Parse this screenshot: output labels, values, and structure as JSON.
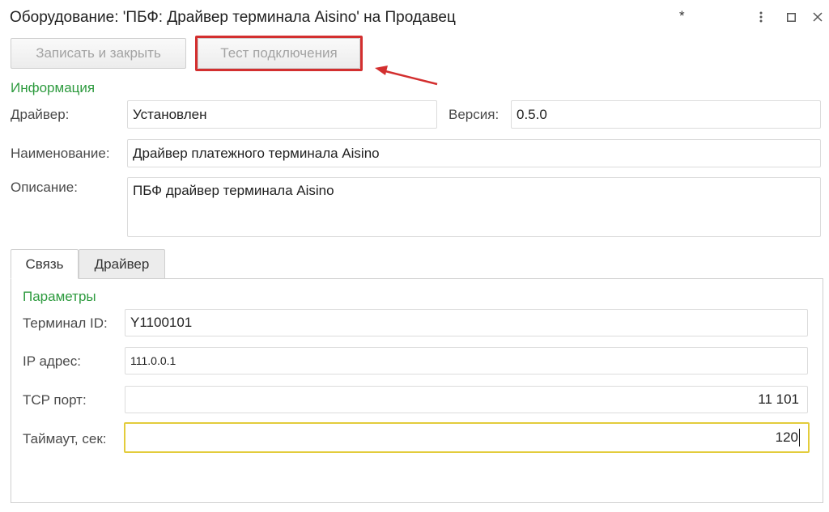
{
  "window": {
    "title": "Оборудование: 'ПБФ: Драйвер терминала Aisino' на Продавец",
    "modified_mark": "*",
    "more_icon": "more-vertical-icon",
    "maximize_icon": "maximize-icon",
    "close_icon": "close-icon"
  },
  "toolbar": {
    "save_close_label": "Записать и закрыть",
    "test_connection_label": "Тест подключения",
    "highlight_color": "#d32f2f"
  },
  "info": {
    "section_title": "Информация",
    "driver_label": "Драйвер:",
    "driver_value": "Установлен",
    "version_label": "Версия:",
    "version_value": "0.5.0",
    "name_label": "Наименование:",
    "name_value": "Драйвер платежного терминала Aisino",
    "description_label": "Описание:",
    "description_value": "ПБФ драйвер терминала Aisino"
  },
  "tabs": [
    {
      "label": "Связь",
      "active": true
    },
    {
      "label": "Драйвер",
      "active": false
    }
  ],
  "params": {
    "section_title": "Параметры",
    "terminal_id_label": "Терминал ID:",
    "terminal_id_value": "Y1100101",
    "ip_label": "IP адрес:",
    "ip_value": "111.0.0.1",
    "tcp_port_label": "TCP порт:",
    "tcp_port_value": "11 101",
    "timeout_label": "Таймаут, сек:",
    "timeout_value": "120"
  },
  "colors": {
    "section_title": "#2e9b3f",
    "focus_border": "#e3cc3b",
    "disabled_text": "#a3a3a3"
  }
}
